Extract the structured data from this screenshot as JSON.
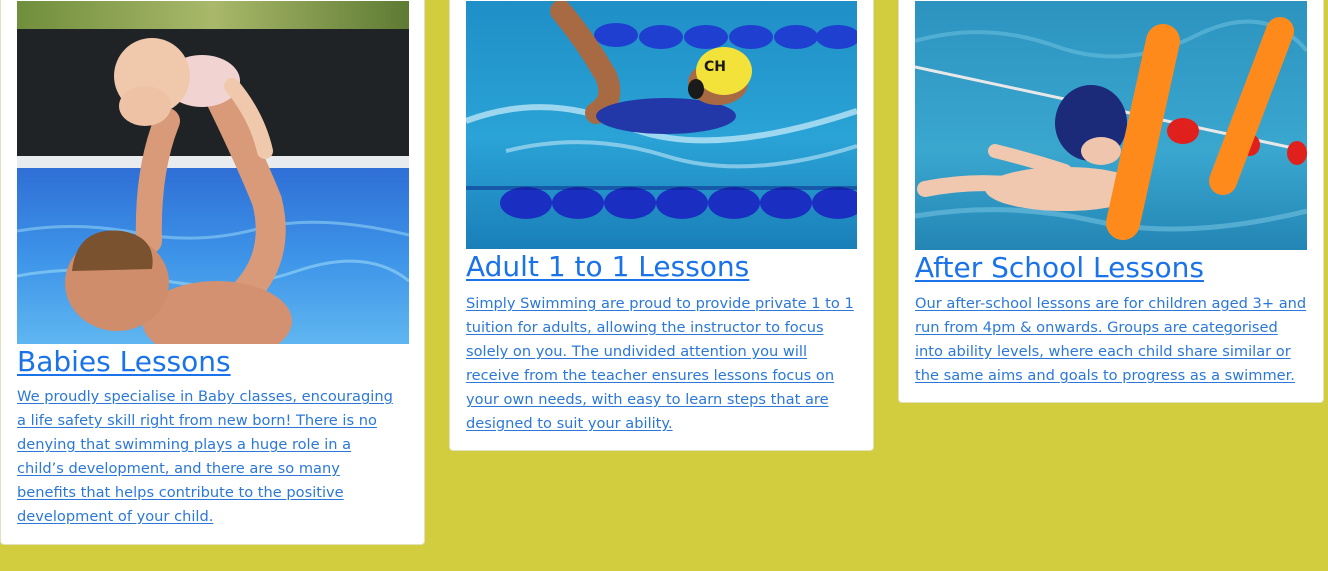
{
  "colors": {
    "background": "#d2cd3f",
    "card": "#ffffff",
    "link": "#1a73e8"
  },
  "cards": [
    {
      "title": "Babies Lessons",
      "image_icon": "parent-baby-pool-photo",
      "description": "We proudly specialise in Baby classes, encouraging a life safety skill right from new born! There is no denying that swimming plays a huge role in a child’s development, and there are so many benefits that helps contribute to the positive development of your child."
    },
    {
      "title": "Adult 1 to 1 Lessons",
      "image_icon": "adult-swimmer-photo",
      "description": "Simply Swimming are proud to provide private 1 to 1 tuition for adults, allowing the instructor to focus solely on you. The undivided attention you will receive from the teacher ensures lessons focus on your own needs, with easy to learn steps that are designed to suit your ability."
    },
    {
      "title": "After School Lessons",
      "image_icon": "child-swimmer-floats-photo",
      "description": "Our after-school lessons are for children aged 3+ and run from 4pm & onwards. Groups are categorised into ability levels, where each child share similar or the same aims and goals to progress as a swimmer."
    }
  ]
}
